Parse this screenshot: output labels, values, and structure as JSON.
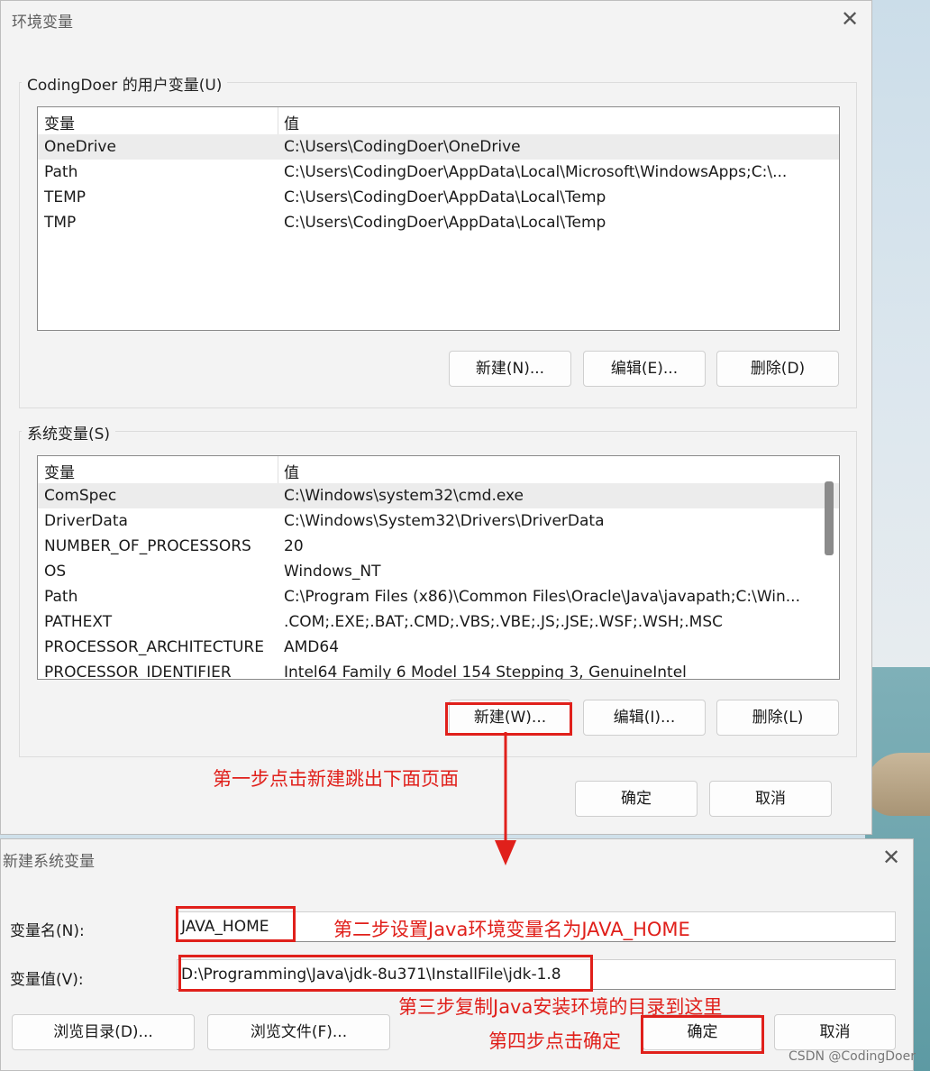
{
  "env_dialog": {
    "title": "环境变量",
    "user_group_label": "CodingDoer 的用户变量(U)",
    "system_group_label": "系统变量(S)",
    "columns": [
      "变量",
      "值"
    ],
    "user_vars": [
      {
        "name": "OneDrive",
        "value": "C:\\Users\\CodingDoer\\OneDrive"
      },
      {
        "name": "Path",
        "value": "C:\\Users\\CodingDoer\\AppData\\Local\\Microsoft\\WindowsApps;C:\\..."
      },
      {
        "name": "TEMP",
        "value": "C:\\Users\\CodingDoer\\AppData\\Local\\Temp"
      },
      {
        "name": "TMP",
        "value": "C:\\Users\\CodingDoer\\AppData\\Local\\Temp"
      }
    ],
    "system_vars": [
      {
        "name": "ComSpec",
        "value": "C:\\Windows\\system32\\cmd.exe"
      },
      {
        "name": "DriverData",
        "value": "C:\\Windows\\System32\\Drivers\\DriverData"
      },
      {
        "name": "NUMBER_OF_PROCESSORS",
        "value": "20"
      },
      {
        "name": "OS",
        "value": "Windows_NT"
      },
      {
        "name": "Path",
        "value": "C:\\Program Files (x86)\\Common Files\\Oracle\\Java\\javapath;C:\\Win..."
      },
      {
        "name": "PATHEXT",
        "value": ".COM;.EXE;.BAT;.CMD;.VBS;.VBE;.JS;.JSE;.WSF;.WSH;.MSC"
      },
      {
        "name": "PROCESSOR_ARCHITECTURE",
        "value": "AMD64"
      },
      {
        "name": "PROCESSOR_IDENTIFIER",
        "value": "Intel64 Family 6 Model 154 Stepping 3, GenuineIntel"
      }
    ],
    "user_buttons": {
      "new": "新建(N)...",
      "edit": "编辑(E)...",
      "delete": "删除(D)"
    },
    "system_buttons": {
      "new": "新建(W)...",
      "edit": "编辑(I)...",
      "delete": "删除(L)"
    },
    "ok": "确定",
    "cancel": "取消"
  },
  "new_dialog": {
    "title": "新建系统变量",
    "name_label": "变量名(N):",
    "name_value": "JAVA_HOME",
    "value_label": "变量值(V):",
    "value_value": "D:\\Programming\\Java\\jdk-8u371\\InstallFile\\jdk-1.8",
    "browse_dir": "浏览目录(D)...",
    "browse_file": "浏览文件(F)...",
    "ok": "确定",
    "cancel": "取消"
  },
  "annotations": {
    "step1": "第一步点击新建跳出下面页面",
    "step2": "第二步设置Java环境变量名为JAVA_HOME",
    "step3": "第三步复制Java安装环境的目录到这里",
    "step4": "第四步点击确定"
  },
  "watermark": "CSDN @CodingDoer",
  "icons": {
    "close": "close-icon",
    "arrow": "arrow-down-icon"
  },
  "colors": {
    "annotation": "#e0201b",
    "dialog_bg": "#f3f3f3"
  }
}
